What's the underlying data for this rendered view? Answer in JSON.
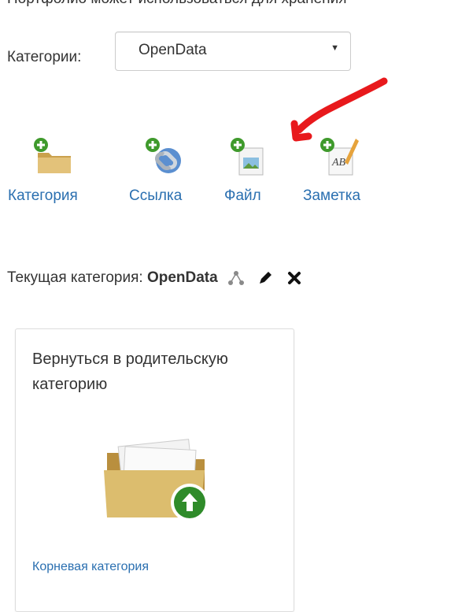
{
  "header": {
    "intro_text": "Портфолио может использоваться для хранения"
  },
  "category_select": {
    "label": "Категории:",
    "selected": "OpenData"
  },
  "actions": [
    {
      "label": "Категория",
      "icon": "add-folder-icon"
    },
    {
      "label": "Ссылка",
      "icon": "add-link-icon"
    },
    {
      "label": "Файл",
      "icon": "add-file-icon"
    },
    {
      "label": "Заметка",
      "icon": "add-note-icon"
    }
  ],
  "current_category": {
    "label": "Текущая категория:",
    "name": "OpenData"
  },
  "parent_card": {
    "title": "Вернуться в родительскую категорию",
    "link": "Корневая категория",
    "icon": "folder-up-icon"
  },
  "colors": {
    "link": "#2a6fb0",
    "annotation_arrow": "#e8191c",
    "add_badge": "#3f9a2c"
  }
}
